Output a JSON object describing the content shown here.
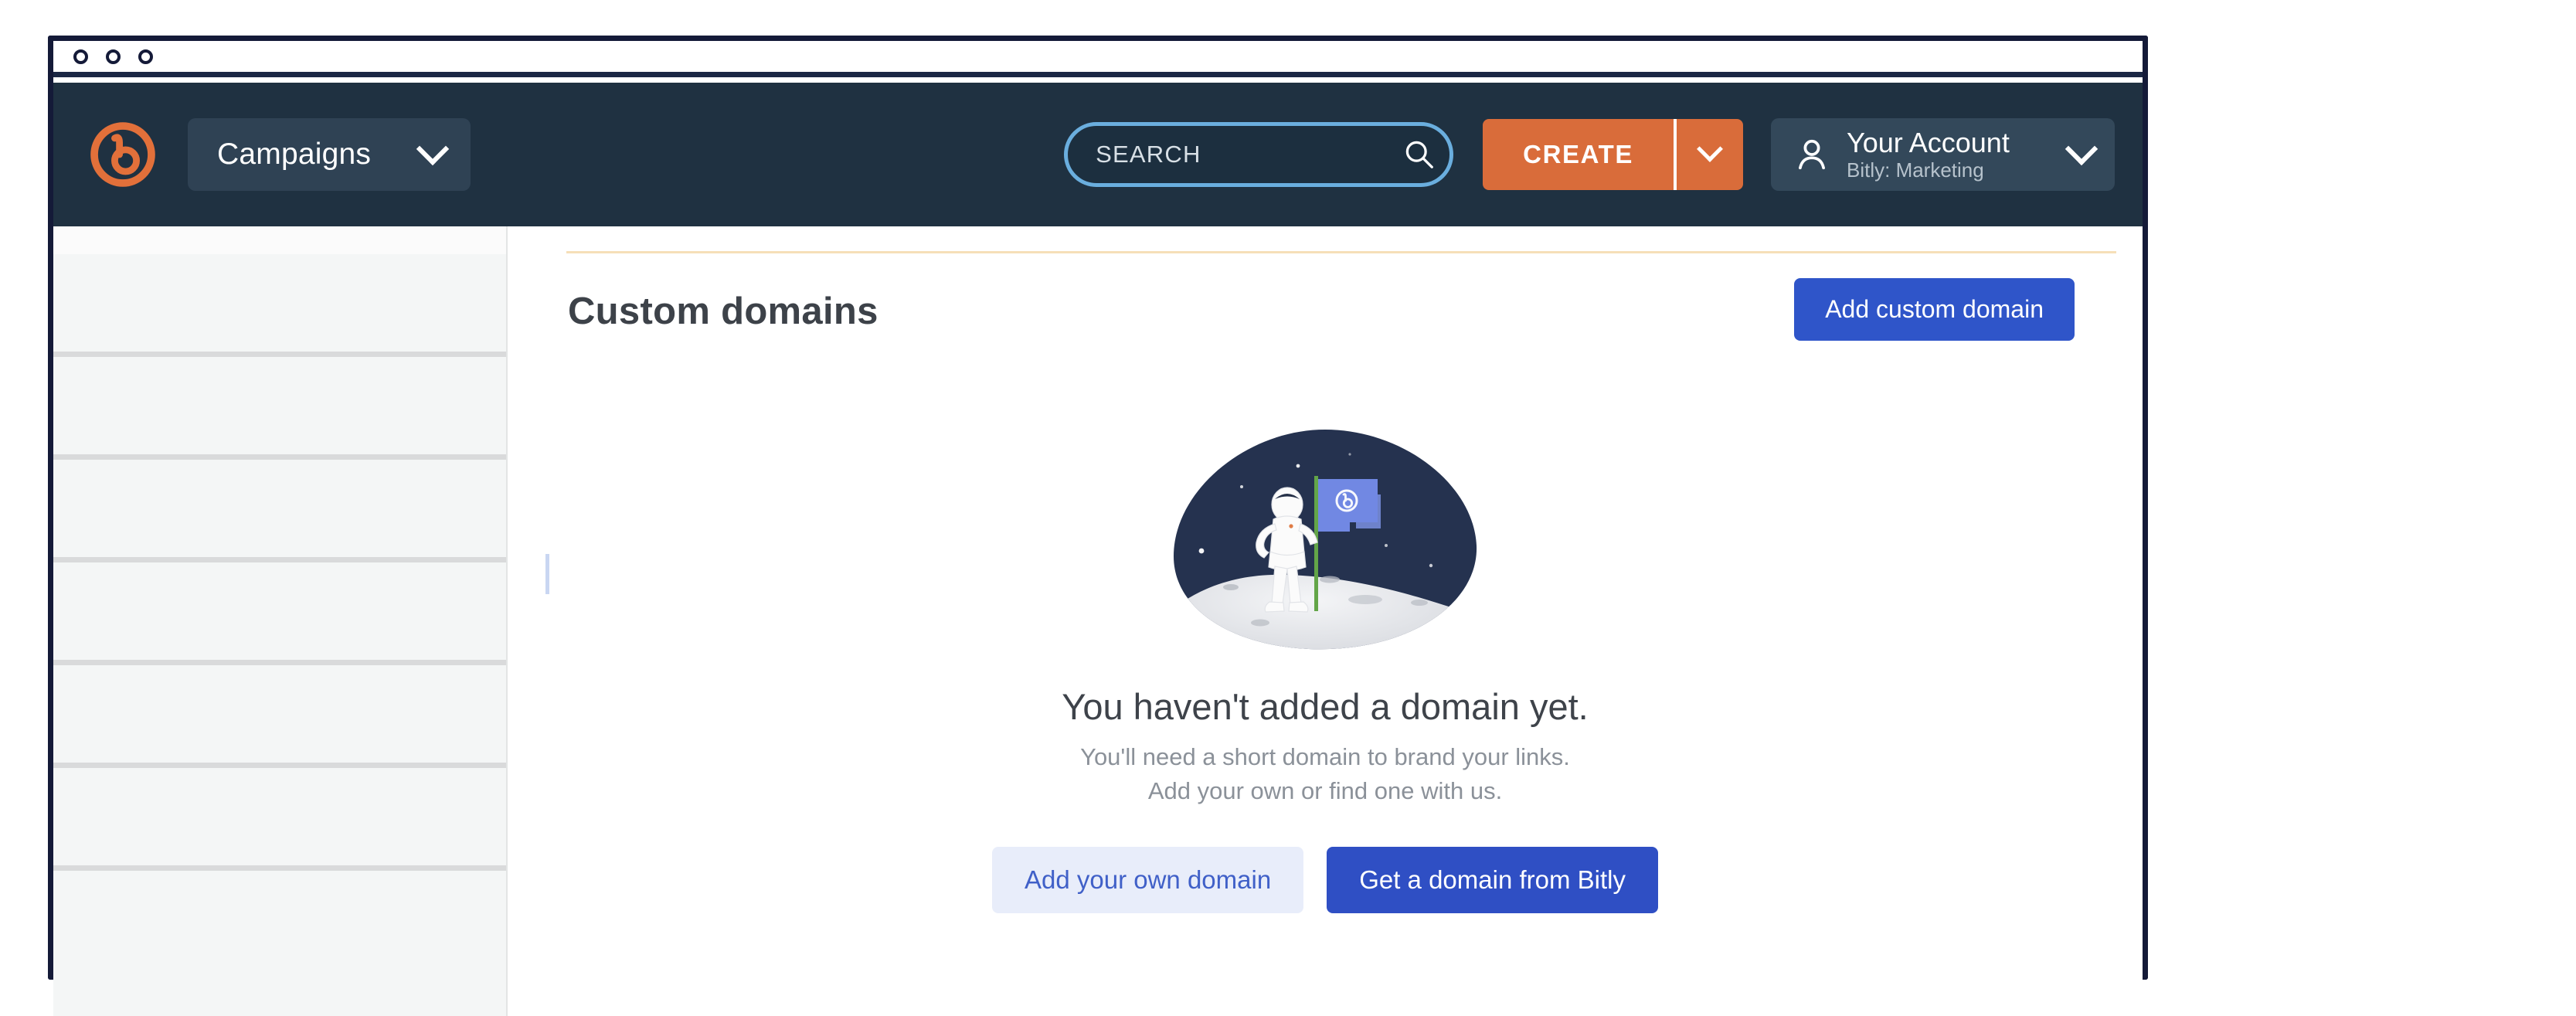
{
  "window": {
    "traffic_lights": [
      "circle-1",
      "circle-2",
      "circle-3"
    ]
  },
  "top_nav": {
    "logo_label": "Bitly",
    "workspace_selector": {
      "label": "Campaigns",
      "chevron": "chevron-down-icon"
    },
    "search": {
      "placeholder": "SEARCH",
      "value": "",
      "icon": "search-icon",
      "focused": true
    },
    "create": {
      "label": "CREATE",
      "dropdown_chevron": "chevron-down-icon"
    },
    "account": {
      "icon": "person-icon",
      "name": "Your Account",
      "organization": "Bitly: Marketing",
      "chevron": "chevron-down-icon"
    }
  },
  "sidebar": {
    "state": "loading",
    "skeleton_rows": 7
  },
  "main": {
    "page_title": "Custom domains",
    "primary_action": "Add custom domain",
    "empty_state": {
      "illustration": "astronaut-planting-bitly-flag-on-moon",
      "heading": "You haven't added a domain yet.",
      "subtext_line_1": "You'll need a short domain to brand your links.",
      "subtext_line_2": "Add your own or find one with us.",
      "secondary_button": "Add your own domain",
      "primary_button": "Get a domain from Bitly"
    }
  },
  "colors": {
    "nav_background": "#1f3141",
    "brand_orange": "#d96c3a",
    "accent_blue": "#2f55c9",
    "soft_blue": "#e8edfa",
    "rule_tan": "#f6dfb8",
    "frame_navy": "#141a38"
  }
}
